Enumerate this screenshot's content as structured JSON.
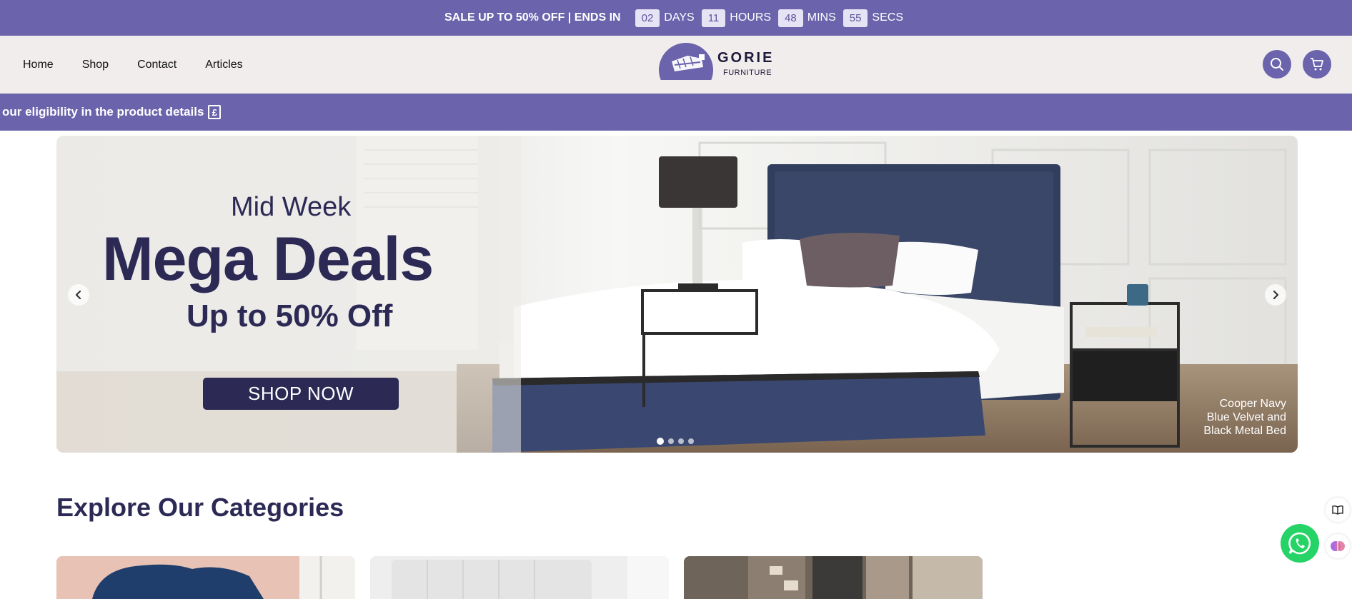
{
  "sale_bar": {
    "text": "SALE UP TO 50% OFF | ENDS IN",
    "days_value": "02",
    "days_label": "DAYS",
    "hours_value": "11",
    "hours_label": "HOURS",
    "mins_value": "48",
    "mins_label": "MINS",
    "secs_value": "55",
    "secs_label": "SECS"
  },
  "nav": {
    "items": [
      {
        "label": "Home"
      },
      {
        "label": "Shop"
      },
      {
        "label": "Contact"
      },
      {
        "label": "Articles"
      }
    ]
  },
  "logo": {
    "brand": "GORIE",
    "sub": "FURNITURE"
  },
  "promo": {
    "text": "our eligibility in the product details",
    "icon_glyph": "£"
  },
  "hero": {
    "line1": "Mid Week",
    "line2": "Mega Deals",
    "line3": "Up to 50% Off",
    "button": "SHOP NOW",
    "caption_1": "Cooper Navy",
    "caption_2": "Blue Velvet and",
    "caption_3": "Black Metal Bed",
    "slide_count": 4,
    "active_slide": 1
  },
  "categories": {
    "title": "Explore Our Categories"
  },
  "colors": {
    "brand": "#6b63ab",
    "dark_text": "#2c2a55",
    "whatsapp": "#25d366"
  },
  "icons": {
    "search": "search-icon",
    "cart": "cart-icon",
    "prev": "chevron-left-icon",
    "next": "chevron-right-icon",
    "whatsapp": "whatsapp-icon"
  }
}
